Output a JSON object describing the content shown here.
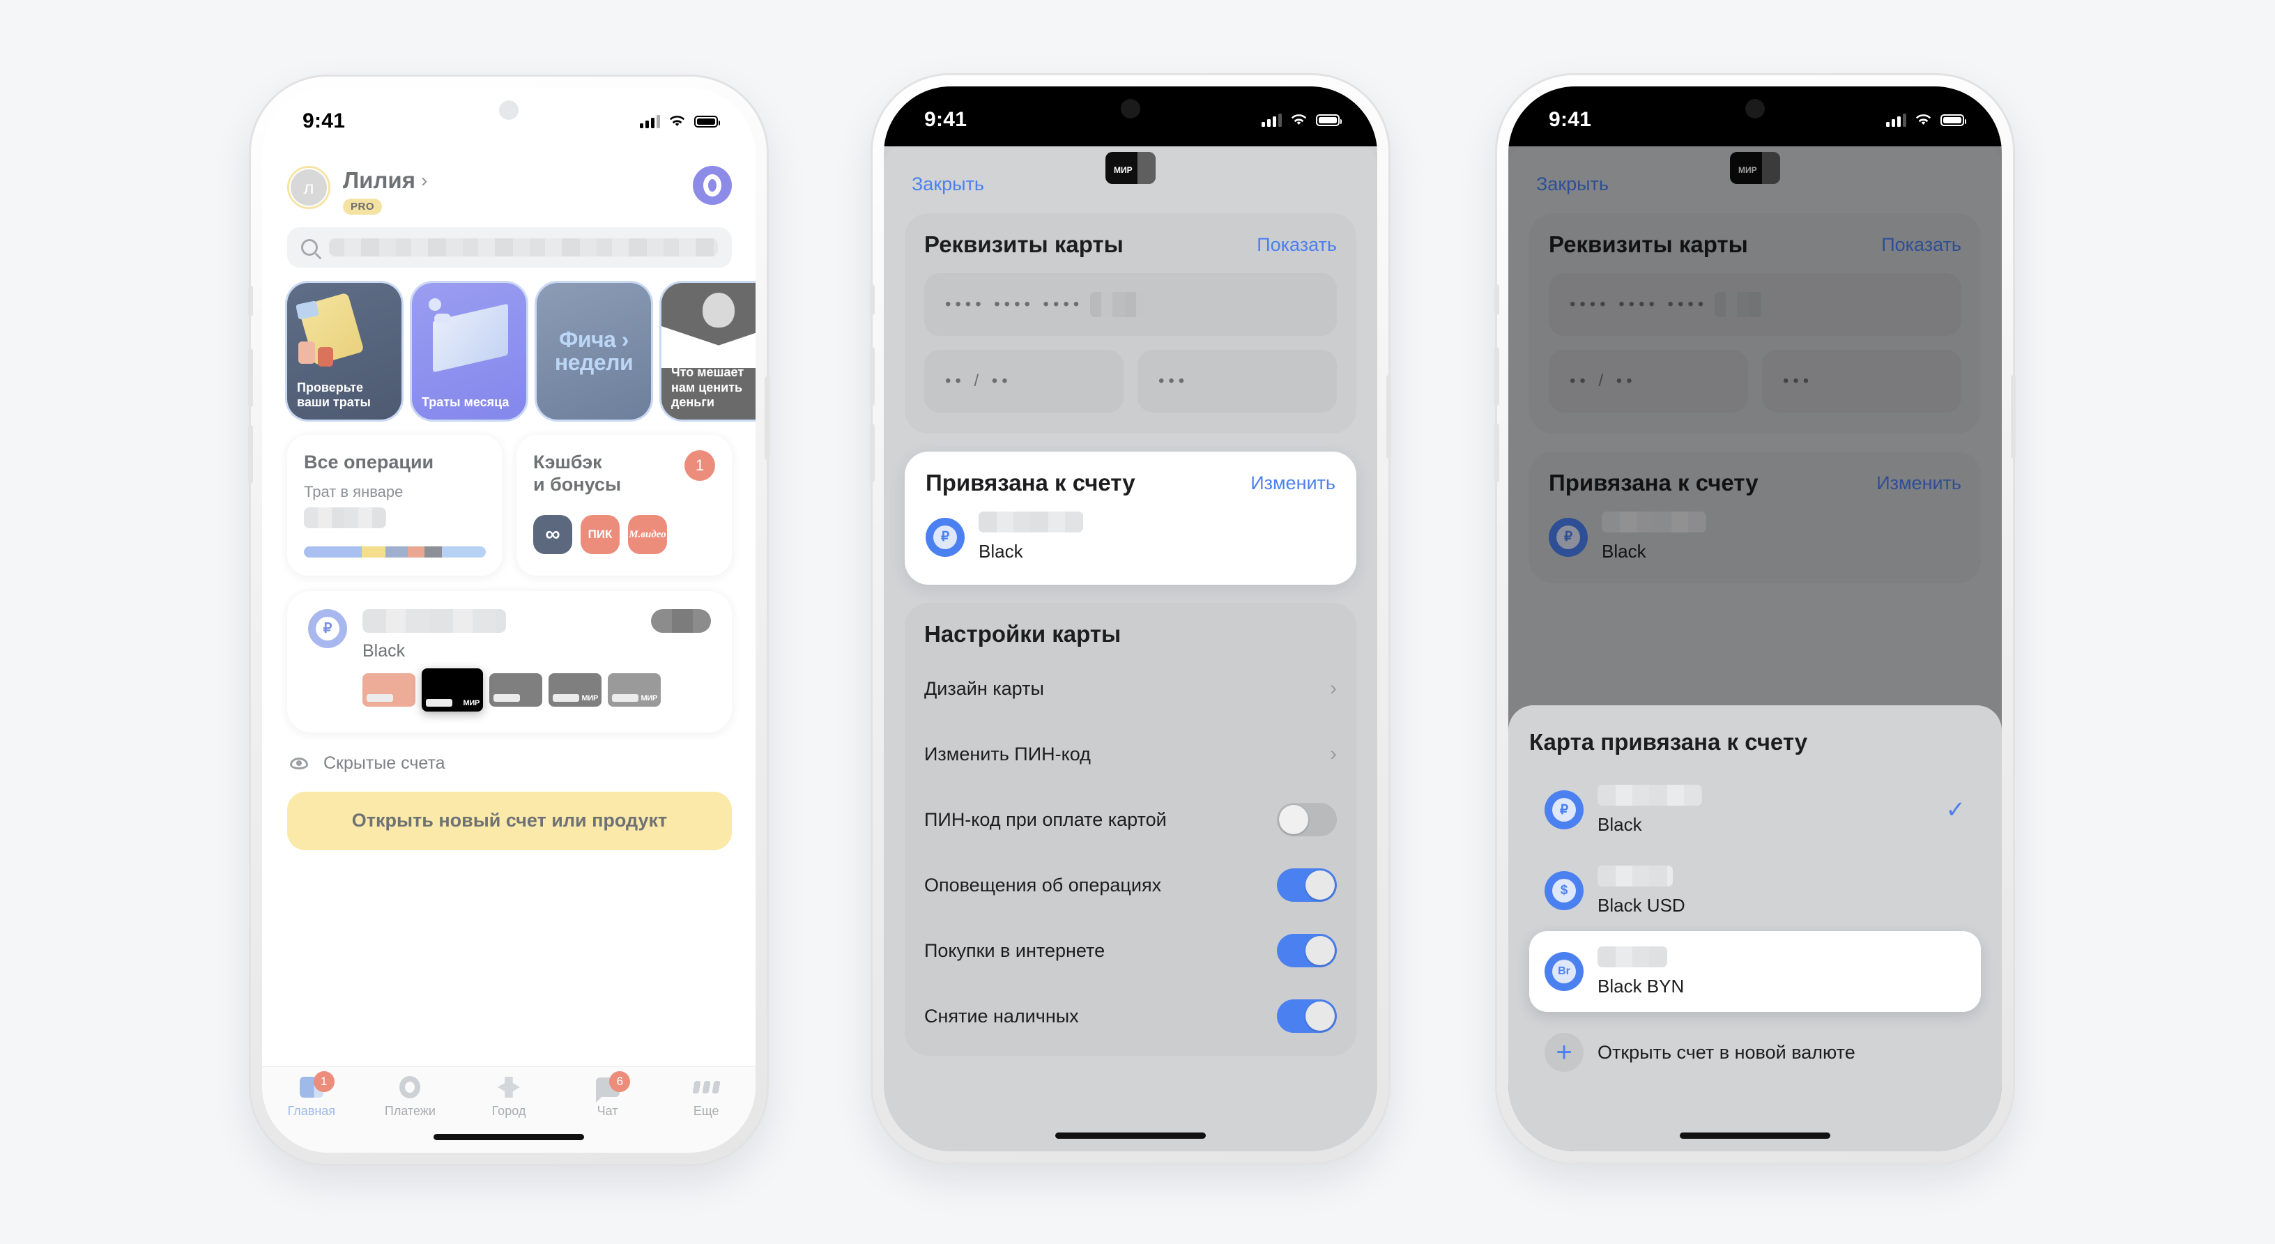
{
  "status_bar": {
    "time": "9:41"
  },
  "phone1": {
    "header": {
      "avatar_initial": "л",
      "name": "Лилия",
      "chevron": "›",
      "pro_badge": "PRO",
      "account_initial": "О"
    },
    "search": {
      "placeholder": ""
    },
    "stories": [
      {
        "caption": "Проверьте\nваши траты",
        "line1": "Проверьте",
        "line2": "ваши траты"
      },
      {
        "caption": "Траты месяца",
        "line1": "Траты месяца",
        "line2": ""
      },
      {
        "big1": "Фича ›",
        "big2": "недели"
      },
      {
        "line1": "Что мешает",
        "line2": "нам ценить",
        "line3": "деньги"
      }
    ],
    "tiles": {
      "operations": {
        "title": "Все операции",
        "subtitle": "Трат в январе"
      },
      "cashback": {
        "title_line1": "Кэшбэк",
        "title_line2": "и бонусы",
        "badge": "1",
        "logos": [
          "∞",
          "ПИК",
          "М.видео"
        ]
      }
    },
    "account": {
      "currency_symbol": "₽",
      "name_label": "Black"
    },
    "hidden_accounts": "Скрытые счета",
    "cta": "Открыть новый счет или продукт",
    "tabs": [
      {
        "label": "Главная",
        "badge": "1",
        "active": true
      },
      {
        "label": "Платежи",
        "badge": "",
        "active": false
      },
      {
        "label": "Город",
        "badge": "",
        "active": false
      },
      {
        "label": "Чат",
        "badge": "6",
        "active": false
      },
      {
        "label": "Еще",
        "badge": "",
        "active": false
      }
    ]
  },
  "phone2": {
    "nav": {
      "close": "Закрыть",
      "card_brand": "МИР"
    },
    "requisites": {
      "title": "Реквизиты карты",
      "action": "Показать",
      "number_mask": "••••  ••••  ••••",
      "expiry_mask": "•• / ••",
      "cvc_mask": "•••"
    },
    "linked": {
      "title": "Привязана к счету",
      "action": "Изменить",
      "currency_symbol": "₽",
      "account_label": "Black"
    },
    "settings": {
      "title": "Настройки карты",
      "rows": [
        {
          "label": "Дизайн карты",
          "type": "chevron",
          "chevron": "›"
        },
        {
          "label": "Изменить ПИН-код",
          "type": "chevron",
          "chevron": "›"
        },
        {
          "label": "ПИН-код при оплате картой",
          "type": "toggle",
          "on": false
        },
        {
          "label": "Оповещения об операциях",
          "type": "toggle",
          "on": true
        },
        {
          "label": "Покупки в интернете",
          "type": "toggle",
          "on": true
        },
        {
          "label": "Снятие наличных",
          "type": "toggle",
          "on": true
        }
      ]
    }
  },
  "phone3": {
    "nav": {
      "close": "Закрыть",
      "card_brand": "МИР"
    },
    "requisites": {
      "title": "Реквизиты карты",
      "action": "Показать",
      "number_mask": "••••  ••••  ••••",
      "expiry_mask": "•• / ••",
      "cvc_mask": "•••"
    },
    "linked": {
      "title": "Привязана к счету",
      "action": "Изменить",
      "currency_symbol": "₽",
      "account_label": "Black"
    },
    "sheet": {
      "title": "Карта привязана к счету",
      "options": [
        {
          "symbol": "₽",
          "label": "Black",
          "selected": true,
          "check": "✓"
        },
        {
          "symbol": "$",
          "label": "Black USD",
          "selected": false,
          "check": ""
        },
        {
          "symbol": "Br",
          "label": "Black BYN",
          "selected": false,
          "check": "",
          "highlighted": true
        }
      ],
      "add_row": {
        "icon": "+",
        "label": "Открыть счет в новой валюте"
      }
    }
  },
  "colors": {
    "accent_blue": "#4b80f0",
    "yellow_cta": "#fae9a8",
    "badge_red": "#ec8d7c",
    "sheet_gray": "#d2d3d5",
    "page_bg": "#f5f6f8"
  }
}
